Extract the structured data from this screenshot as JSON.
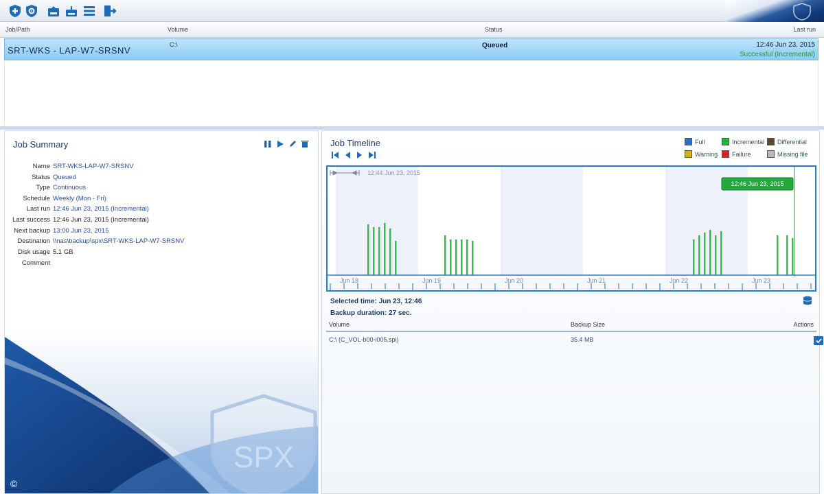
{
  "toolbar": {
    "buttons": [
      {
        "name": "new-job-button",
        "icon": "shield-plus-icon"
      },
      {
        "name": "new-image-job-button",
        "icon": "shield-gear-icon"
      },
      {
        "name": "restore-button",
        "icon": "restore-disk-icon"
      },
      {
        "name": "download-button",
        "icon": "download-disk-icon"
      },
      {
        "name": "list-button",
        "icon": "list-icon"
      },
      {
        "name": "exit-button",
        "icon": "exit-door-icon"
      }
    ]
  },
  "grid": {
    "headers": [
      "Job/Path",
      "Volume",
      "Status",
      "Last run"
    ],
    "row": {
      "name": "SRT-WKS - LAP-W7-SRSNV",
      "volume": "C:\\",
      "status": "Queued",
      "time": "12:46 Jun 23, 2015",
      "sub": "Successful (Incremental)"
    }
  },
  "summary": {
    "title": "Job Summary",
    "fields": [
      {
        "label": "Name",
        "value": "SRT-WKS-LAP-W7-SRSNV"
      },
      {
        "label": "Status",
        "value": "Queued"
      },
      {
        "label": "Type",
        "value": "Continuous"
      },
      {
        "label": "Schedule",
        "value": "Weekly (Mon - Fri)"
      },
      {
        "label": "Last run",
        "value": "12:46 Jun 23, 2015 (Incremental)"
      },
      {
        "label": "Last success",
        "value": "12:46 Jun 23, 2015 (Incremental)"
      },
      {
        "label": "Next backup",
        "value": "13:00 Jun 23, 2015"
      },
      {
        "label": "Destination",
        "value": "\\\\nas\\backup\\spx\\SRT-WKS-LAP-W7-SRSNV"
      },
      {
        "label": "Disk usage",
        "value": "5.1 GB"
      },
      {
        "label": "Comment",
        "value": ""
      }
    ],
    "watermark": "SPX",
    "copyright": "©"
  },
  "timeline": {
    "title": "Job Timeline",
    "range_label": "12:44 Jun 23, 2015",
    "callout": "12:46 Jun 23, 2015",
    "legend": [
      {
        "label": "Full",
        "color": "#2f6ec0"
      },
      {
        "label": "Incremental",
        "color": "#22b33a"
      },
      {
        "label": "Differential",
        "color": "#5b4630"
      },
      {
        "label": "Warning",
        "color": "#d4b01c"
      },
      {
        "label": "Failure",
        "color": "#d2282a"
      },
      {
        "label": "Missing file",
        "color": "#b9b9b9"
      }
    ]
  },
  "chart_data": {
    "type": "bar",
    "categories": [
      "Jun 18",
      "Jun 19",
      "Jun 20",
      "Jun 21",
      "Jun 22",
      "Jun 23"
    ],
    "series": [
      {
        "name": "Incremental",
        "values": [
          6,
          6,
          0,
          0,
          6,
          3
        ]
      }
    ],
    "tick_labels": [
      "Jun 18",
      "Jun 19",
      "Jun 20",
      "Jun 21",
      "Jun 22",
      "Jun 23"
    ]
  },
  "details": {
    "selected_time": "Selected time: Jun 23, 12:46",
    "backup_duration": "Backup duration: 27 sec.",
    "columns": [
      "Volume",
      "Backup Size",
      "Actions"
    ],
    "volume_row": {
      "volume": "C:\\ (C_VOL-b00-i005.spi)",
      "size": "35.4 MB"
    }
  }
}
